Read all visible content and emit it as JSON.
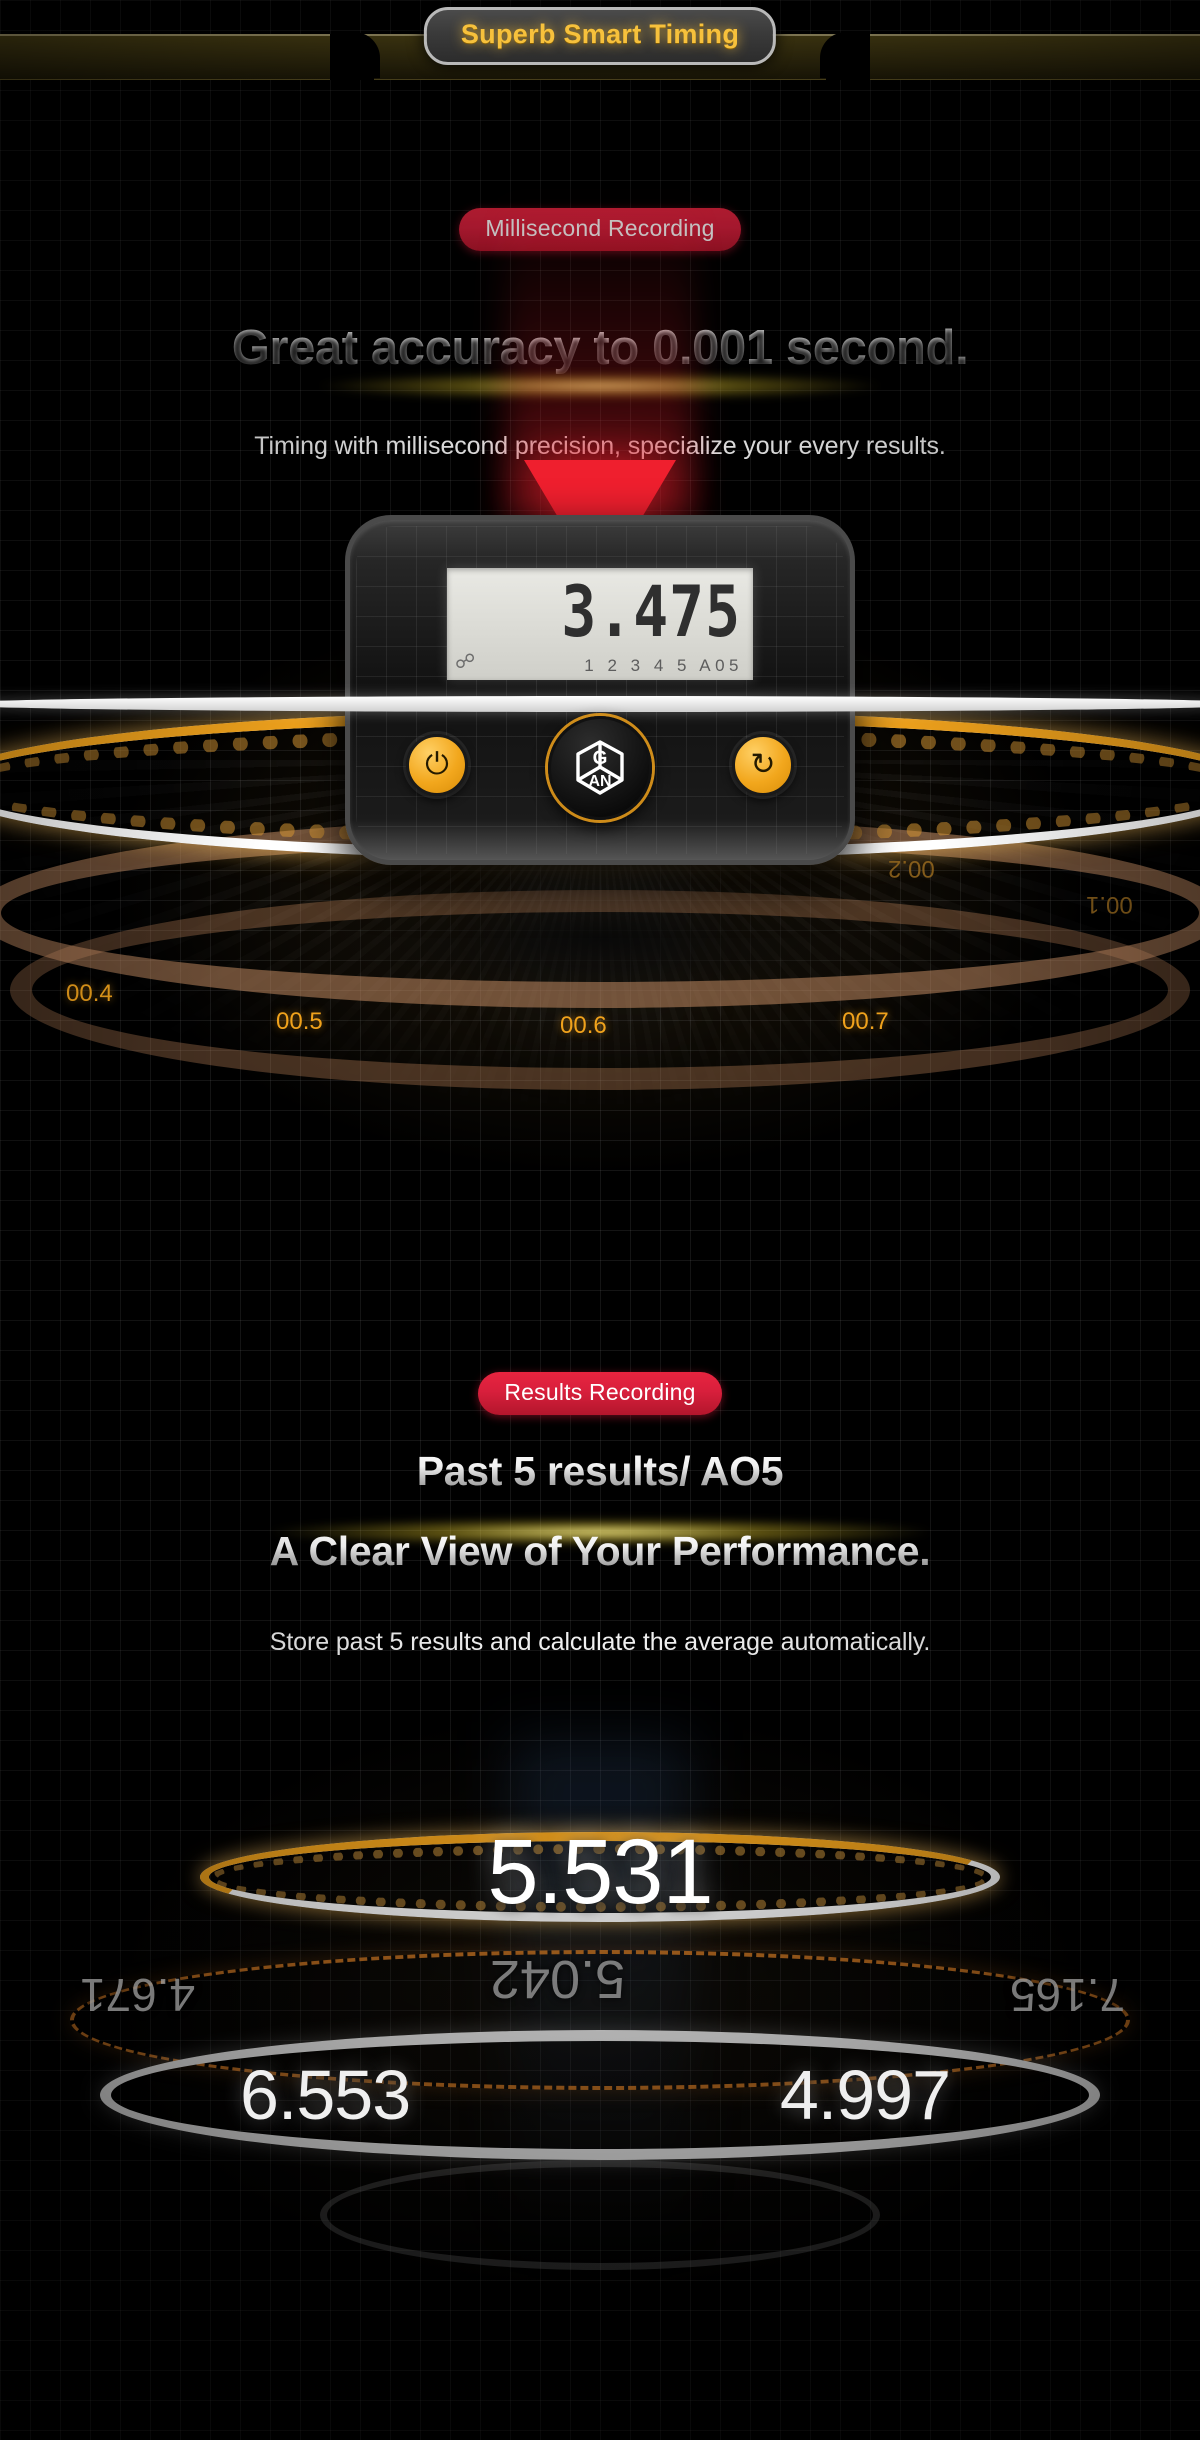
{
  "header": {
    "title": "Superb Smart Timing"
  },
  "section_timing": {
    "badge": "Millisecond Recording",
    "headline": "Great accuracy to 0.001 second.",
    "subtitle": "Timing with millisecond precision, specialize your every results."
  },
  "device": {
    "lcd_time": "3.475",
    "lcd_indices": "1 2 3 4 5 A05",
    "bluetooth_icon": "bluetooth-icon",
    "power_icon": "power-icon",
    "reset_icon": "reset-icon",
    "brand_logo": "gan-cube-logo"
  },
  "dial_ticks": {
    "front": [
      "00.4",
      "00.5",
      "00.6",
      "00.7"
    ],
    "back": [
      "00.2",
      "00.1"
    ]
  },
  "section_results": {
    "badge": "Results Recording",
    "headline_1": "Past 5 results/ AO5",
    "headline_2": "A Clear View of Your Performance.",
    "subtitle": "Store past 5 results and calculate the average automatically."
  },
  "results": {
    "main": "5.531",
    "left": "6.553",
    "right": "4.997",
    "back_center": "5.042",
    "back_left": "4.671",
    "back_right": "7.165"
  },
  "colors": {
    "accent_gold": "#f0a21c",
    "badge_red": "#d81f3c",
    "title_gold": "#f7c13c",
    "pointer_red": "#ef1f2e"
  }
}
